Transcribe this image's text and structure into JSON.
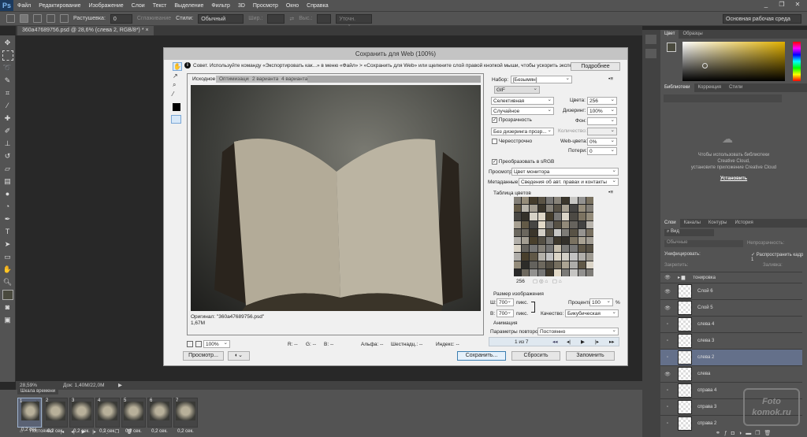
{
  "app": {
    "logo": "Ps",
    "menu": [
      "Файл",
      "Редактирование",
      "Изображение",
      "Слои",
      "Текст",
      "Выделение",
      "Фильтр",
      "3D",
      "Просмотр",
      "Окно",
      "Справка"
    ],
    "window_buttons": [
      "_",
      "❐",
      "✕"
    ]
  },
  "options": {
    "feather_label": "Растушевка:",
    "feather_value": "0 пикс.",
    "antialias": "Сглаживание",
    "style_label": "Стили:",
    "style_value": "Обычный",
    "width_label": "Шир.:",
    "height_label": "Выс.:",
    "refine": "Уточн. край...",
    "workspace": "Основная рабочая среда"
  },
  "document": {
    "tab": "360a47689756.psd @ 28,6% (слева 2, RGB/8*) *",
    "close": "×",
    "zoom": "28,59%",
    "doc_size": "Док: 1,40M/22,0M"
  },
  "dialog": {
    "title": "Сохранить для Web (100%)",
    "hint": "Совет. Используйте команду «Экспортировать как...» в меню «Файл» > «Сохранить для Web» или щелкните слой правой кнопкой мыши, чтобы ускорить экспорт ресурсов",
    "more": "Подробнее",
    "tabs": [
      "Исходное",
      "Оптимизация",
      "2 варианта",
      "4 варианта"
    ],
    "original_label": "Оригинал: \"360a47689756.psd\"",
    "original_size": "1,67M",
    "zoom": "100%",
    "readouts": [
      "R: --",
      "G: --",
      "B: --",
      "Альфа: --",
      "Шестнадц.: --",
      "Индекс: --"
    ],
    "preview_btn": "Просмотр...",
    "save_btn": "Сохранить...",
    "reset_btn": "Сбросить",
    "remember_btn": "Запомнить",
    "settings": {
      "preset_label": "Набор:",
      "preset": "[Безымян]",
      "format": "GIF",
      "reduction": "Селективная",
      "dither_algo": "Случайное",
      "colors_label": "Цвета:",
      "colors": "256",
      "dither_label": "Дизеринг:",
      "dither": "100%",
      "transparency": "Прозрачность",
      "matte_label": "Фон:",
      "trans_dither": "Без дизеринга прозр...",
      "amount_label": "Количество:",
      "interlaced": "Чересстрочно",
      "websnap_label": "Web-цвета:",
      "websnap": "0%",
      "lossy_label": "Потери:",
      "lossy": "0",
      "srgb": "Преобразовать в sRGB",
      "preview_label": "Просмотр:",
      "preview_value": "Цвет монитора",
      "metadata_label": "Метаданные:",
      "metadata_value": "Сведения об авт. правах и контакты",
      "color_table": "Таблица цветов",
      "color_count": "256"
    },
    "size": {
      "title": "Размер изображения",
      "w_label": "Ш:",
      "w": "700",
      "h_label": "В:",
      "h": "700",
      "unit": "пикс.",
      "percent_label": "Проценты:",
      "percent": "100",
      "pct": "%",
      "quality_label": "Качество:",
      "quality": "Бикубическая"
    },
    "animation": {
      "title": "Анимация",
      "loop_label": "Параметры повторов:",
      "loop": "Постоянно",
      "frame": "1 из 7"
    }
  },
  "right": {
    "color_tabs": [
      "Цвет",
      "Образцы"
    ],
    "lib_tabs": [
      "Библиотеки",
      "Коррекция",
      "Стили"
    ],
    "lib_msg1": "Чтобы использовать библиотеки",
    "lib_msg2": "Creative Cloud,",
    "lib_msg3": "установите приложение Creative Cloud",
    "install": "Установить",
    "layer_tabs": [
      "Слои",
      "Каналы",
      "Контуры",
      "История"
    ],
    "kind": "Вид",
    "blend": "Обычные",
    "opacity_label": "Непрозрачность:",
    "unify": "Унифицировать:",
    "propagate": "Распространить кадр 1",
    "lock": "Закрепить:",
    "fill_label": "Заливка:",
    "layers": [
      {
        "name": "тонировка",
        "visible": true,
        "group": true
      },
      {
        "name": "Слой 6",
        "visible": true
      },
      {
        "name": "Слой 5",
        "visible": true
      },
      {
        "name": "слева 4",
        "visible": false
      },
      {
        "name": "слева 3",
        "visible": false
      },
      {
        "name": "слева 2",
        "visible": false,
        "selected": true
      },
      {
        "name": "слева",
        "visible": true
      },
      {
        "name": "справа 4",
        "visible": false
      },
      {
        "name": "справа 3",
        "visible": false
      },
      {
        "name": "справа 2",
        "visible": false
      }
    ],
    "watermark": "Foto komok.ru"
  },
  "timeline": {
    "title": "Шкала времени",
    "frames": [
      {
        "n": "1",
        "d": "0,2 сек."
      },
      {
        "n": "2",
        "d": "0,2 сек."
      },
      {
        "n": "3",
        "d": "0,2 сек."
      },
      {
        "n": "4",
        "d": "0,2 сек."
      },
      {
        "n": "5",
        "d": "0,2 сек."
      },
      {
        "n": "6",
        "d": "0,2 сек."
      },
      {
        "n": "7",
        "d": "0,2 сек."
      }
    ],
    "loop": "Постоянно"
  }
}
